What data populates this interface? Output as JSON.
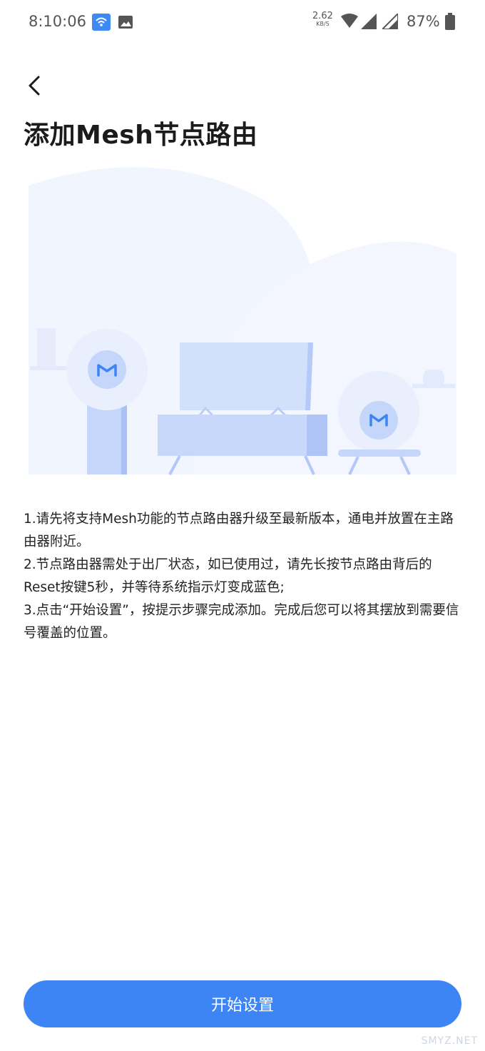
{
  "status_bar": {
    "time": "8:10:06",
    "net_speed": "2.62",
    "net_speed_unit": "KB/S",
    "battery": "87%"
  },
  "header": {
    "title": "添加Mesh节点路由"
  },
  "instructions": [
    "1.请先将支持Mesh功能的节点路由器升级至最新版本，通电并放置在主路由器附近。",
    "2.节点路由器需处于出厂状态，如已使用过，请先长按节点路由背后的Reset按键5秒，并等待系统指示灯变成蓝色;",
    "3.点击“开始设置”，按提示步骤完成添加。完成后您可以将其摆放到需要信号覆盖的位置。"
  ],
  "actions": {
    "start_label": "开始设置"
  },
  "watermark": "SMYZ.NET",
  "colors": {
    "accent": "#3d84f4",
    "illustration_light": "#eef3fd",
    "illustration_mid": "#c9d9fb"
  }
}
